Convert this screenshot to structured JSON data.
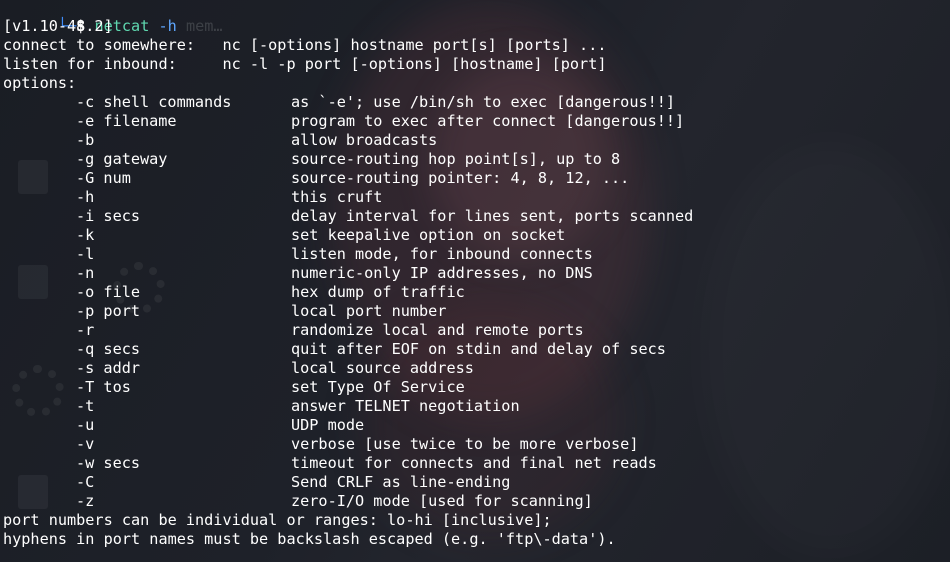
{
  "prompt": {
    "corner": "└─",
    "dollar": "$",
    "command": "netcat",
    "argument": "-h",
    "ghost_suggestion": "mem…"
  },
  "output": {
    "version": "[v1.10-48.2]",
    "usage": [
      "connect to somewhere:   nc [-options] hostname port[s] [ports] ...",
      "listen for inbound:     nc -l -p port [-options] [hostname] [port]"
    ],
    "options_header": "options:",
    "options": [
      {
        "flag": "-c shell commands",
        "description": "as `-e'; use /bin/sh to exec [dangerous!!]"
      },
      {
        "flag": "-e filename",
        "description": "program to exec after connect [dangerous!!]"
      },
      {
        "flag": "-b",
        "description": "allow broadcasts"
      },
      {
        "flag": "-g gateway",
        "description": "source-routing hop point[s], up to 8"
      },
      {
        "flag": "-G num",
        "description": "source-routing pointer: 4, 8, 12, ..."
      },
      {
        "flag": "-h",
        "description": "this cruft"
      },
      {
        "flag": "-i secs",
        "description": "delay interval for lines sent, ports scanned"
      },
      {
        "flag": "-k",
        "description": "set keepalive option on socket"
      },
      {
        "flag": "-l",
        "description": "listen mode, for inbound connects"
      },
      {
        "flag": "-n",
        "description": "numeric-only IP addresses, no DNS"
      },
      {
        "flag": "-o file",
        "description": "hex dump of traffic"
      },
      {
        "flag": "-p port",
        "description": "local port number"
      },
      {
        "flag": "-r",
        "description": "randomize local and remote ports"
      },
      {
        "flag": "-q secs",
        "description": "quit after EOF on stdin and delay of secs"
      },
      {
        "flag": "-s addr",
        "description": "local source address"
      },
      {
        "flag": "-T tos",
        "description": "set Type Of Service"
      },
      {
        "flag": "-t",
        "description": "answer TELNET negotiation"
      },
      {
        "flag": "-u",
        "description": "UDP mode"
      },
      {
        "flag": "-v",
        "description": "verbose [use twice to be more verbose]"
      },
      {
        "flag": "-w secs",
        "description": "timeout for connects and final net reads"
      },
      {
        "flag": "-C",
        "description": "Send CRLF as line-ending"
      },
      {
        "flag": "-z",
        "description": "zero-I/O mode [used for scanning]"
      }
    ],
    "footer": [
      "port numbers can be individual or ranges: lo-hi [inclusive];",
      "hyphens in port names must be backslash escaped (e.g. 'ftp\\-data')."
    ]
  },
  "colors": {
    "background": "#1b1f27",
    "text": "#ffffff",
    "prompt": "#3f8df7",
    "command": "#5fd7af"
  }
}
